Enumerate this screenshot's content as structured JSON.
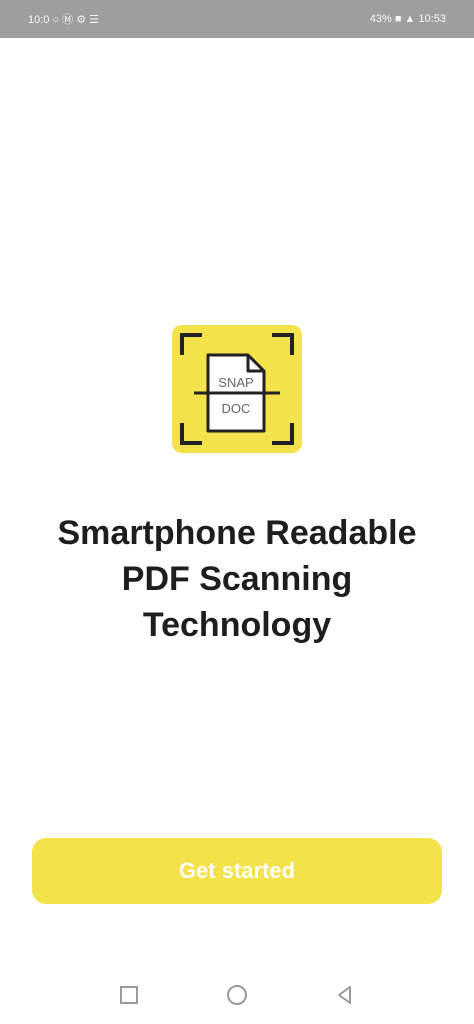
{
  "status_bar": {
    "left_text": "10:0 ○ Ⓜ ⚙ ☰",
    "right_text": "43% ■ ▲ 10:53"
  },
  "logo": {
    "line1": "SNAP",
    "line2": "DOC"
  },
  "headline": {
    "line1": "Smartphone Readable",
    "line2": "PDF Scanning",
    "line3": "Technology"
  },
  "cta": {
    "label": "Get started"
  },
  "nav_bar": {
    "icons": [
      "recent-apps-icon",
      "home-icon",
      "back-icon"
    ]
  },
  "colors": {
    "accent": "#f4e24a",
    "status_bar_bg": "#9e9e9e",
    "headline": "#1e1e1e",
    "cta_text": "#ffffff"
  }
}
